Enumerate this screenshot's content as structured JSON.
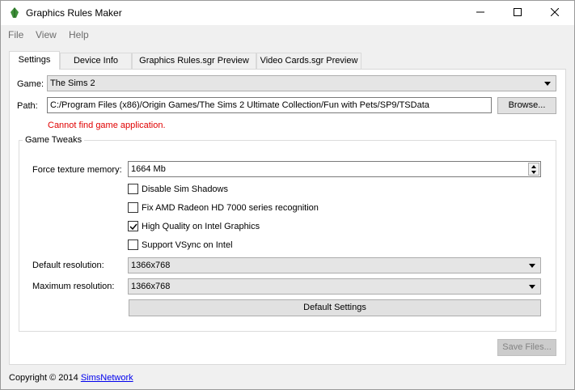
{
  "window": {
    "title": "Graphics Rules Maker",
    "icon": "leaf-icon"
  },
  "menu": [
    "File",
    "View",
    "Help"
  ],
  "tabs": [
    "Settings",
    "Device Info",
    "Graphics Rules.sgr Preview",
    "Video Cards.sgr Preview"
  ],
  "game": {
    "label": "Game:",
    "value": "The Sims 2"
  },
  "path": {
    "label": "Path:",
    "value": "C:/Program Files (x86)/Origin Games/The Sims 2 Ultimate Collection/Fun with Pets/SP9/TSData",
    "browse_label": "Browse...",
    "error": "Cannot find game application."
  },
  "tweaks": {
    "title": "Game Tweaks",
    "texture_label": "Force texture memory:",
    "texture_value": "1664 Mb",
    "checkboxes": [
      {
        "label": "Disable Sim Shadows",
        "checked": false
      },
      {
        "label": "Fix AMD Radeon HD 7000 series recognition",
        "checked": false
      },
      {
        "label": "High Quality on Intel Graphics",
        "checked": true
      },
      {
        "label": "Support VSync on Intel",
        "checked": false
      }
    ],
    "default_res_label": "Default resolution:",
    "default_res_value": "1366x768",
    "max_res_label": "Maximum resolution:",
    "max_res_value": "1366x768",
    "default_settings_label": "Default Settings"
  },
  "save_label": "Save Files...",
  "footer": {
    "copyright": "Copyright © 2014",
    "link": "SimsNetwork"
  },
  "colors": {
    "error": "#e00000",
    "link": "#0000ee"
  }
}
